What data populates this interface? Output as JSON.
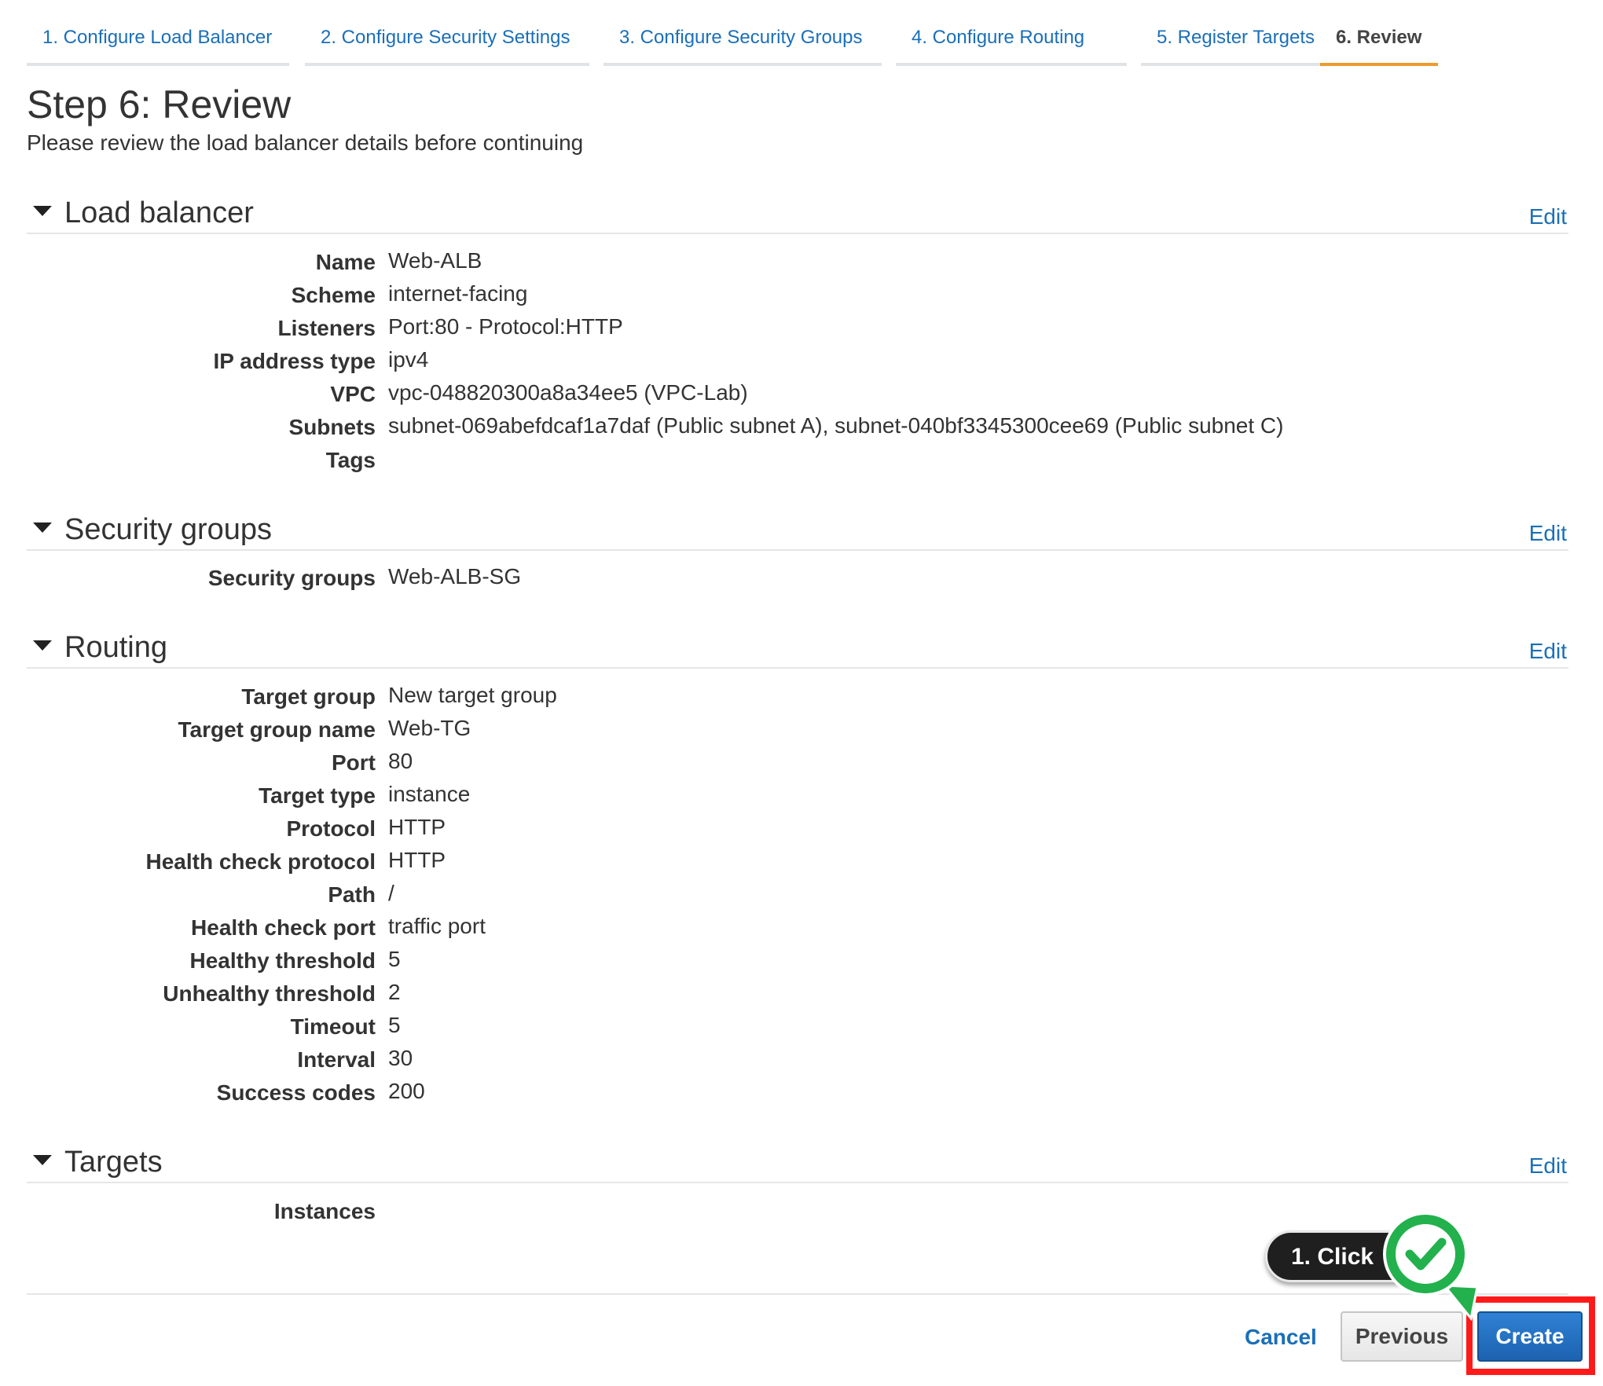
{
  "wizard": {
    "tabs": [
      {
        "label": "1. Configure Load Balancer"
      },
      {
        "label": "2. Configure Security Settings"
      },
      {
        "label": "3. Configure Security Groups"
      },
      {
        "label": "4. Configure Routing"
      },
      {
        "label": "5. Register Targets"
      },
      {
        "label": "6. Review"
      }
    ],
    "active_tab": 6
  },
  "page": {
    "title": "Step 6: Review",
    "subtitle": "Please review the load balancer details before continuing"
  },
  "sections": {
    "load_balancer": {
      "title": "Load balancer",
      "edit_label": "Edit",
      "rows": [
        {
          "key": "Name",
          "value": "Web-ALB"
        },
        {
          "key": "Scheme",
          "value": "internet-facing"
        },
        {
          "key": "Listeners",
          "value": "Port:80 - Protocol:HTTP"
        },
        {
          "key": "IP address type",
          "value": "ipv4"
        },
        {
          "key": "VPC",
          "value": "vpc-048820300a8a34ee5 (VPC-Lab)"
        },
        {
          "key": "Subnets",
          "value": "subnet-069abefdcaf1a7daf (Public subnet A), subnet-040bf3345300cee69 (Public subnet C)"
        },
        {
          "key": "Tags",
          "value": ""
        }
      ]
    },
    "security_groups": {
      "title": "Security groups",
      "edit_label": "Edit",
      "rows": [
        {
          "key": "Security groups",
          "value": "Web-ALB-SG"
        }
      ]
    },
    "routing": {
      "title": "Routing",
      "edit_label": "Edit",
      "rows": [
        {
          "key": "Target group",
          "value": "New target group"
        },
        {
          "key": "Target group name",
          "value": "Web-TG"
        },
        {
          "key": "Port",
          "value": "80"
        },
        {
          "key": "Target type",
          "value": "instance"
        },
        {
          "key": "Protocol",
          "value": "HTTP"
        },
        {
          "key": "Health check protocol",
          "value": "HTTP"
        },
        {
          "key": "Path",
          "value": "/"
        },
        {
          "key": "Health check port",
          "value": "traffic port"
        },
        {
          "key": "Healthy threshold",
          "value": "5"
        },
        {
          "key": "Unhealthy threshold",
          "value": "2"
        },
        {
          "key": "Timeout",
          "value": "5"
        },
        {
          "key": "Interval",
          "value": "30"
        },
        {
          "key": "Success codes",
          "value": "200"
        }
      ]
    },
    "targets": {
      "title": "Targets",
      "edit_label": "Edit",
      "rows": [
        {
          "key": "Instances",
          "value": ""
        }
      ]
    }
  },
  "footer": {
    "cancel_label": "Cancel",
    "previous_label": "Previous",
    "create_label": "Create"
  },
  "annotation": {
    "callout_text": "1. Click",
    "icon": "check-circle-icon"
  },
  "colors": {
    "link": "#1b6fb8",
    "active_tab_underline": "#ec9b2e",
    "primary_button": "#1d62b1",
    "highlight": "#ff1a1a",
    "check_green": "#22b14c"
  }
}
